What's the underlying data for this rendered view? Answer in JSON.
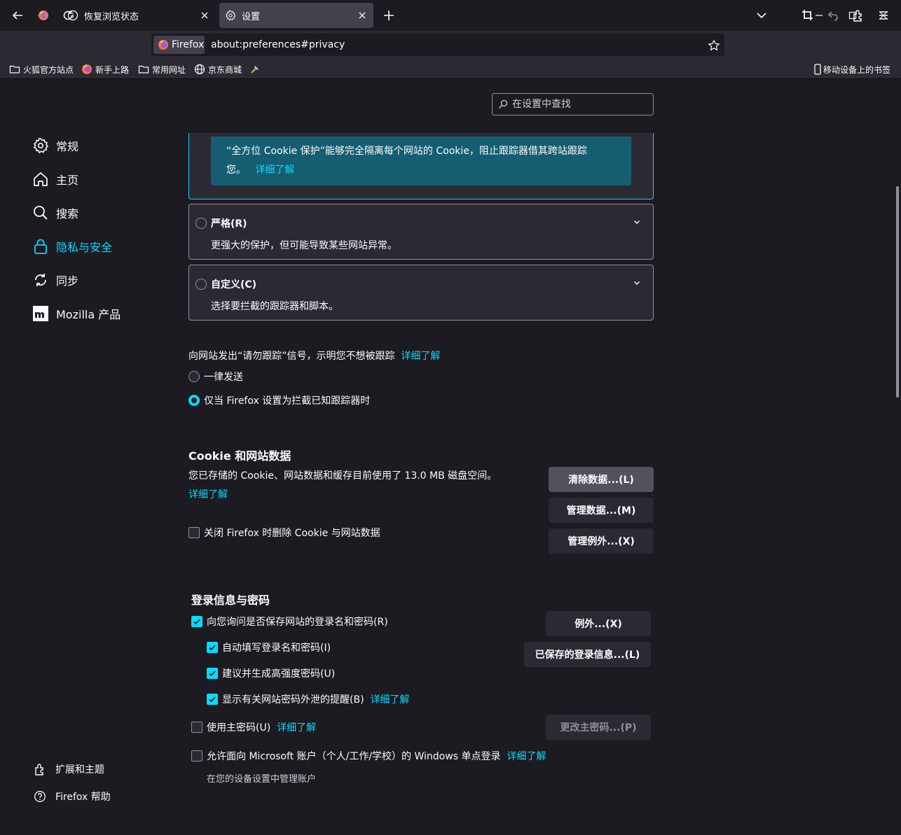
{
  "window": {
    "tabs": [
      {
        "label": ""
      },
      {
        "label": "恢复浏览状态"
      },
      {
        "label": "设置"
      }
    ]
  },
  "navbar": {
    "identity_label": "Firefox",
    "url": "about:preferences#privacy"
  },
  "bookmarks": {
    "items": [
      {
        "label": "火狐官方站点",
        "icon": "folder-icon"
      },
      {
        "label": "新手上路",
        "icon": "firefox-icon"
      },
      {
        "label": "常用网址",
        "icon": "folder-icon"
      },
      {
        "label": "京东商城",
        "icon": "globe-icon"
      }
    ],
    "mobile": "移动设备上的书签"
  },
  "search": {
    "placeholder": "在设置中查找"
  },
  "sidebar": {
    "items": [
      {
        "label": "常规",
        "icon": "gear-icon"
      },
      {
        "label": "主页",
        "icon": "home-icon"
      },
      {
        "label": "搜索",
        "icon": "search-icon"
      },
      {
        "label": "隐私与安全",
        "icon": "lock-icon",
        "selected": true
      },
      {
        "label": "同步",
        "icon": "sync-icon"
      },
      {
        "label": "Mozilla 产品",
        "icon": "mozilla-icon"
      }
    ],
    "footer": [
      {
        "label": "扩展和主题",
        "icon": "puzzle-icon"
      },
      {
        "label": "Firefox 帮助",
        "icon": "help-icon"
      }
    ]
  },
  "tracking": {
    "tcp_text": "“全方位 Cookie 保护”能够完全隔离每个网站的 Cookie，阻止跟踪器借其跨站跟踪您。",
    "tcp_link": "详细了解",
    "strict": {
      "title": "严格(R)",
      "desc": "更强大的保护，但可能导致某些网站异常。"
    },
    "custom": {
      "title": "自定义(C)",
      "desc": "选择要拦截的跟踪器和脚本。"
    }
  },
  "dnt": {
    "text": "向网站发出“请勿跟踪”信号，示明您不想被跟踪",
    "link": "详细了解",
    "options": [
      {
        "label": "一律发送",
        "selected": false
      },
      {
        "label": "仅当 Firefox 设置为拦截已知跟踪器时",
        "selected": true
      }
    ]
  },
  "cookies": {
    "heading": "Cookie 和网站数据",
    "usage": "您已存储的 Cookie、网站数据和缓存目前使用了 13.0 MB 磁盘空间。",
    "link": "详细了解",
    "delete_on_close": "关闭 Firefox 时删除 Cookie 与网站数据",
    "buttons": [
      "清除数据...(L)",
      "管理数据...(M)",
      "管理例外...(X)"
    ]
  },
  "logins": {
    "heading": "登录信息与密码",
    "ask_save": "向您询问是否保存网站的登录名和密码(R)",
    "autofill": "自动填写登录名和密码(I)",
    "suggest": "建议并生成高强度密码(U)",
    "breach": "显示有关网站密码外泄的提醒(B)",
    "breach_link": "详细了解",
    "primary_pw": "使用主密码(U)",
    "primary_link": "详细了解",
    "sso": "允许面向 Microsoft 账户（个人/工作/学校）的 Windows 单点登录",
    "sso_link": "详细了解",
    "sso_sub": "在您的设备设置中管理账户",
    "buttons": {
      "exceptions": "例外...(X)",
      "saved": "已保存的登录信息...(L)",
      "change_pw": "更改主密码...(P)"
    }
  }
}
